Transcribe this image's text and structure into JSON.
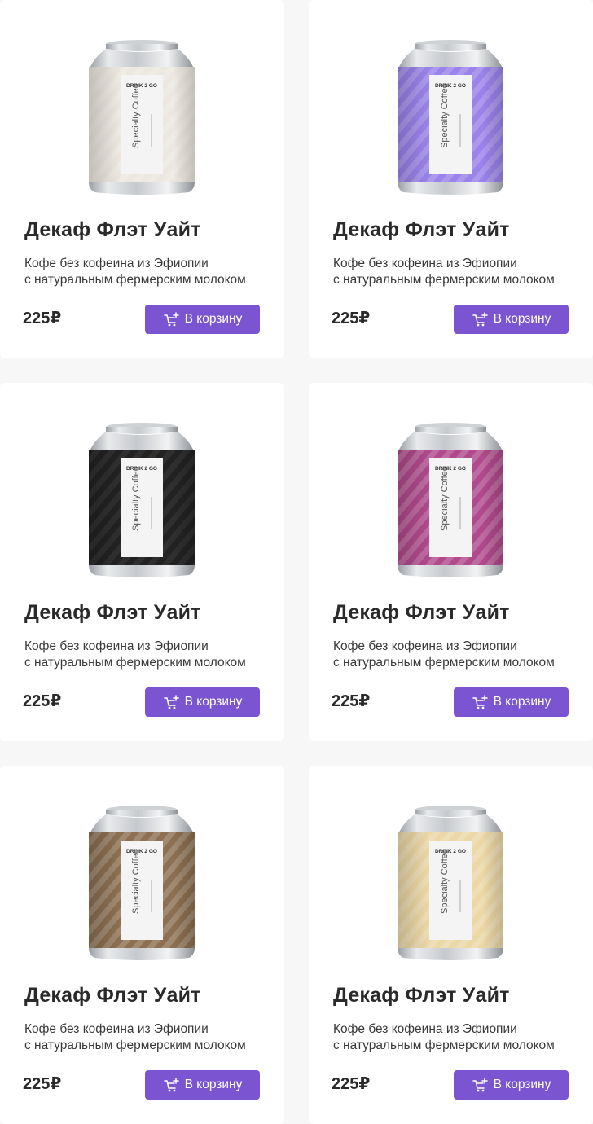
{
  "accent_color": "#7b55d1",
  "products": [
    {
      "title": "Декаф Флэт Уайт",
      "desc_line1": "Кофе без кофеина из Эфиопии",
      "desc_line2": "с натуральным фермерским молоком",
      "price": "225₽",
      "button_label": "В корзину",
      "can_color": "#ece7df",
      "can_brand": "DRINK 2 GO",
      "can_label": "Specialty Coffee"
    },
    {
      "title": "Декаф Флэт Уайт",
      "desc_line1": "Кофе без кофеина из Эфиопии",
      "desc_line2": "с натуральным фермерским молоком",
      "price": "225₽",
      "button_label": "В корзину",
      "can_color": "#9a83ea",
      "can_brand": "DRINK 2 GO",
      "can_label": "Specialty Coffee"
    },
    {
      "title": "Декаф Флэт Уайт",
      "desc_line1": "Кофе без кофеина из Эфиопии",
      "desc_line2": "с натуральным фермерским молоком",
      "price": "225₽",
      "button_label": "В корзину",
      "can_color": "#222222",
      "can_brand": "DRINK 2 GO",
      "can_label": "Specialty Coffee"
    },
    {
      "title": "Декаф Флэт Уайт",
      "desc_line1": "Кофе без кофеина из Эфиопии",
      "desc_line2": "с натуральным фермерским молоком",
      "price": "225₽",
      "button_label": "В корзину",
      "can_color": "#b04a8c",
      "can_brand": "DRINK 2 GO",
      "can_label": "Specialty Coffee"
    },
    {
      "title": "Декаф Флэт Уайт",
      "desc_line1": "Кофе без кофеина из Эфиопии",
      "desc_line2": "с натуральным фермерским молоком",
      "price": "225₽",
      "button_label": "В корзину",
      "can_color": "#8c7051",
      "can_brand": "DRINK 2 GO",
      "can_label": "Specialty Coffee"
    },
    {
      "title": "Декаф Флэт Уайт",
      "desc_line1": "Кофе без кофеина из Эфиопии",
      "desc_line2": "с натуральным фермерским молоком",
      "price": "225₽",
      "button_label": "В корзину",
      "can_color": "#ecd8a6",
      "can_brand": "DRINK 2 GO",
      "can_label": "Specialty Coffee"
    }
  ]
}
